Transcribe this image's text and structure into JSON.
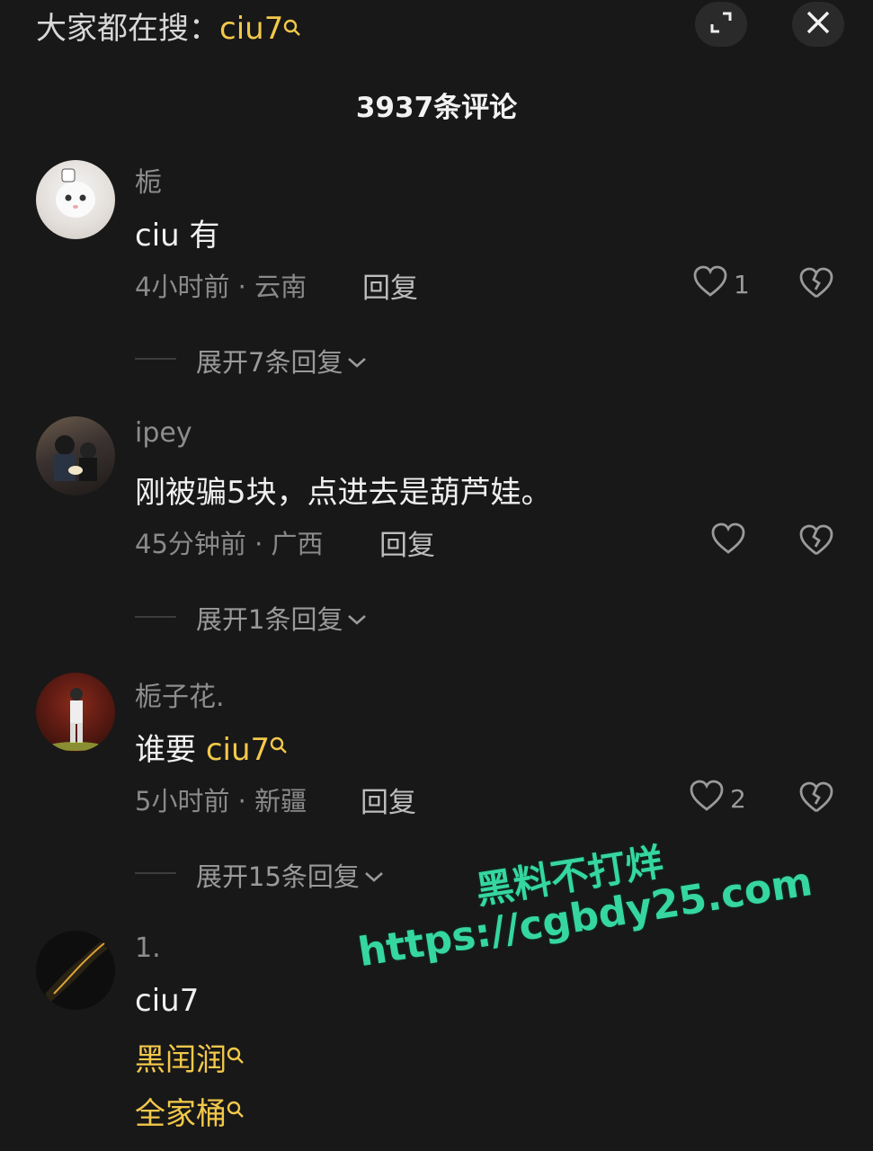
{
  "header": {
    "search_prefix": "大家都在搜：",
    "search_term": "ciu7",
    "expand_icon": "expand-icon",
    "close_icon": "close-icon",
    "comment_count": "3937条评论"
  },
  "comments": [
    {
      "username": "栀",
      "content": "ciu 有",
      "time_location": "4小时前 · 云南",
      "reply_label": "回复",
      "like_count": "1",
      "expand_label": "展开7条回复"
    },
    {
      "username": "ipey",
      "content": "刚被骗5块，点进去是葫芦娃。",
      "time_location": "45分钟前 · 广西",
      "reply_label": "回复",
      "like_count": "",
      "expand_label": "展开1条回复"
    },
    {
      "username": "栀子花.",
      "content_prefix": "谁要 ",
      "content_link": "ciu7",
      "time_location": "5小时前 · 新疆",
      "reply_label": "回复",
      "like_count": "2",
      "expand_label": "展开15条回复"
    },
    {
      "username": "1.",
      "content": "ciu7",
      "link1": "黑闰润",
      "link2": "全家桶"
    }
  ],
  "watermark": {
    "line1": "黑料不打烊",
    "line2": "https://cgbdy25.com"
  },
  "colors": {
    "background": "#181818",
    "highlight": "#f2c84b",
    "watermark": "#36d6a0"
  }
}
